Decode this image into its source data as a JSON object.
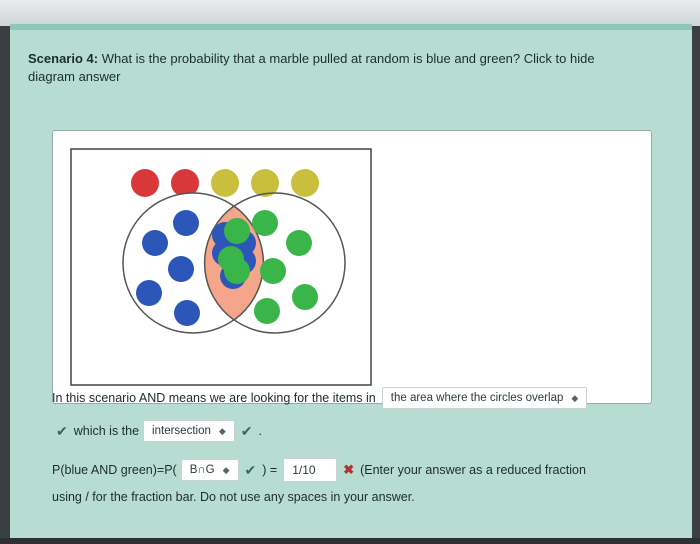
{
  "question": {
    "scenario_label": "Scenario 4:",
    "text": "What is the probability that a marble pulled at random is blue and green? Click to hide diagram answer"
  },
  "diagram": {
    "top_marbles": [
      "red",
      "red",
      "yellow",
      "yellow",
      "yellow"
    ],
    "colors": {
      "red": "#d9383a",
      "yellow": "#c9bf3c",
      "blue": "#2c57b8",
      "green": "#3ab54a",
      "overlap": "#f4a58a"
    }
  },
  "line1": {
    "prefix": "In this scenario AND means we are looking for the items in",
    "dropdown_value": "the area where the circles overlap"
  },
  "line2": {
    "prefix": "which is the",
    "dropdown_value": "intersection",
    "suffix": "."
  },
  "line3": {
    "prefix": "P(blue AND green)=P(",
    "dropdown_value": "B∩G",
    "eq": ") =",
    "answer_value": "1/10",
    "hint": "(Enter your answer as a reduced fraction"
  },
  "line4": {
    "text": "using / for the fraction bar. Do not use any spaces in your answer."
  }
}
